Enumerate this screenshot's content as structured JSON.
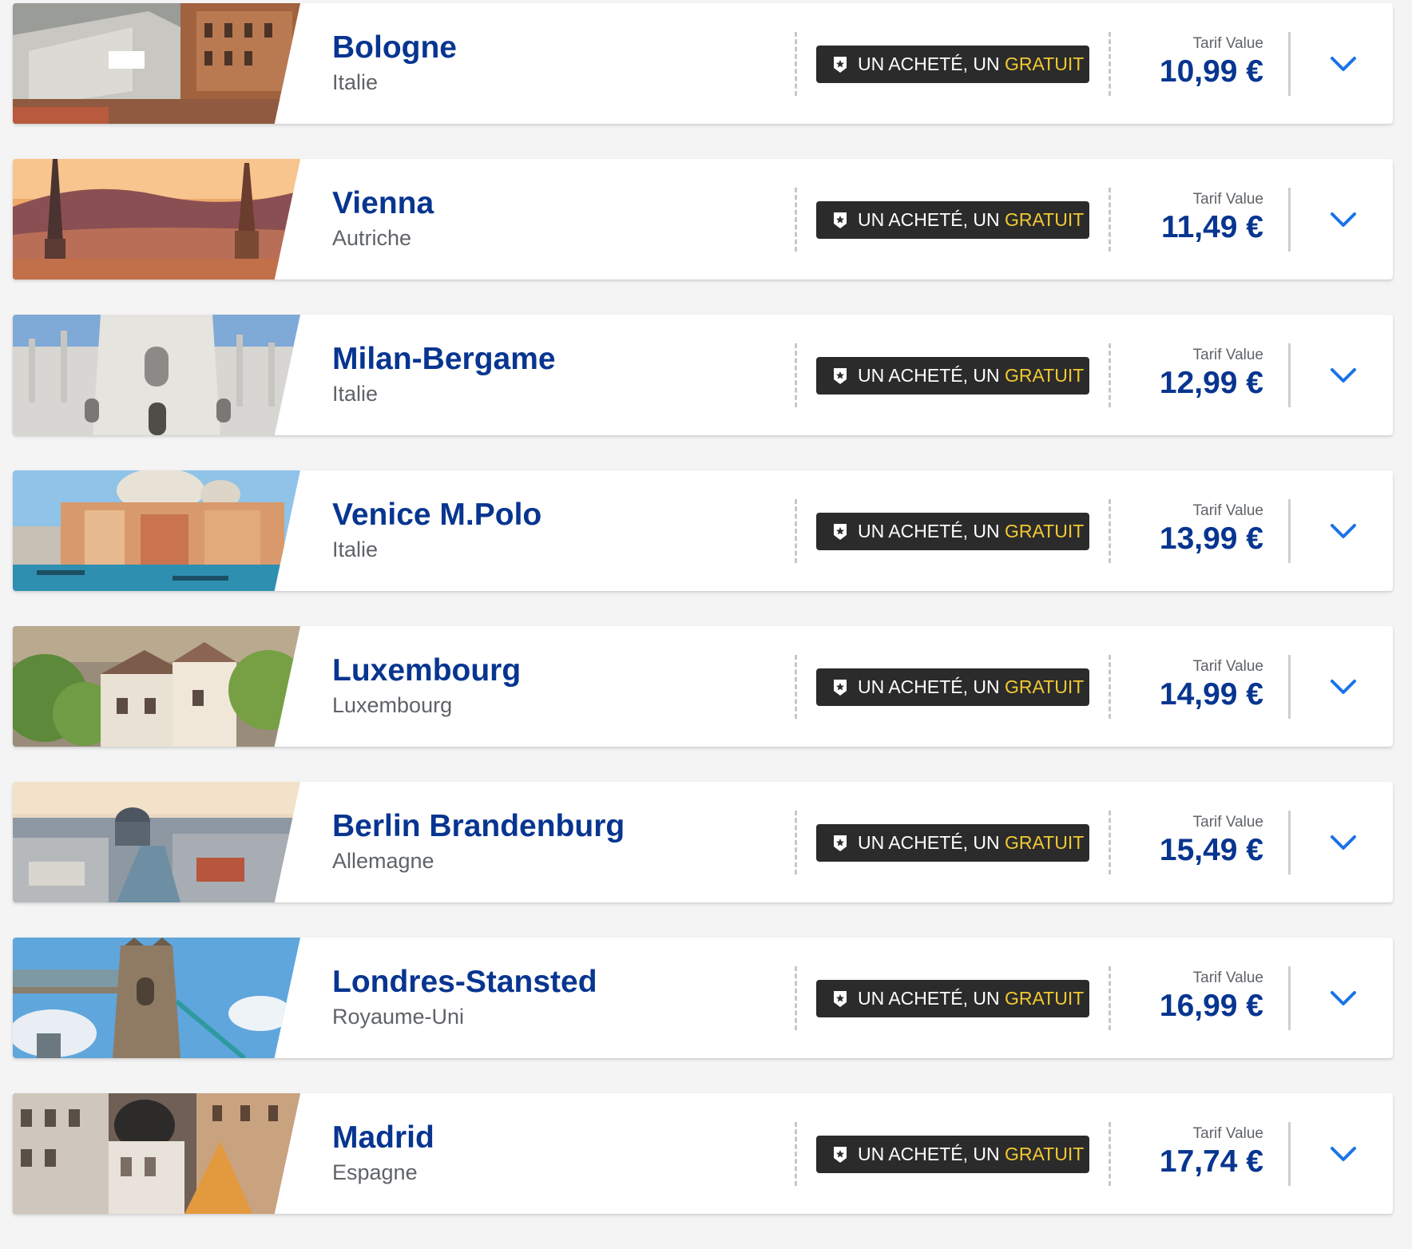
{
  "colors": {
    "primary": "#073590",
    "promo_background": "#2b2b2b",
    "promo_highlight": "#f1c933",
    "chevron": "#1a73e8",
    "muted_text": "#5f6368"
  },
  "icons": {
    "promo": "star-badge-icon",
    "expand": "chevron-down-icon"
  },
  "destinations": [
    {
      "city": "Bologne",
      "country": "Italie",
      "promo_text": "UN ACHETÉ, UN ",
      "promo_highlight": "GRATUIT",
      "fare_label": "Tarif Value",
      "price": "10,99 €",
      "image": "bologna-towers"
    },
    {
      "city": "Vienna",
      "country": "Autriche",
      "promo_text": "UN ACHETÉ, UN ",
      "promo_highlight": "GRATUIT",
      "fare_label": "Tarif Value",
      "price": "11,49 €",
      "image": "vienna-skyline"
    },
    {
      "city": "Milan-Bergame",
      "country": "Italie",
      "promo_text": "UN ACHETÉ, UN ",
      "promo_highlight": "GRATUIT",
      "fare_label": "Tarif Value",
      "price": "12,99 €",
      "image": "milan-cathedral"
    },
    {
      "city": "Venice M.Polo",
      "country": "Italie",
      "promo_text": "UN ACHETÉ, UN ",
      "promo_highlight": "GRATUIT",
      "fare_label": "Tarif Value",
      "price": "13,99 €",
      "image": "venice-canal"
    },
    {
      "city": "Luxembourg",
      "country": "Luxembourg",
      "promo_text": "UN ACHETÉ, UN ",
      "promo_highlight": "GRATUIT",
      "fare_label": "Tarif Value",
      "price": "14,99 €",
      "image": "luxembourg-old-town"
    },
    {
      "city": "Berlin Brandenburg",
      "country": "Allemagne",
      "promo_text": "UN ACHETÉ, UN ",
      "promo_highlight": "GRATUIT",
      "fare_label": "Tarif Value",
      "price": "15,49 €",
      "image": "berlin-panorama"
    },
    {
      "city": "Londres-Stansted",
      "country": "Royaume-Uni",
      "promo_text": "UN ACHETÉ, UN ",
      "promo_highlight": "GRATUIT",
      "fare_label": "Tarif Value",
      "price": "16,99 €",
      "image": "tower-bridge"
    },
    {
      "city": "Madrid",
      "country": "Espagne",
      "promo_text": "UN ACHETÉ, UN ",
      "promo_highlight": "GRATUIT",
      "fare_label": "Tarif Value",
      "price": "17,74 €",
      "image": "madrid-gran-via"
    }
  ]
}
